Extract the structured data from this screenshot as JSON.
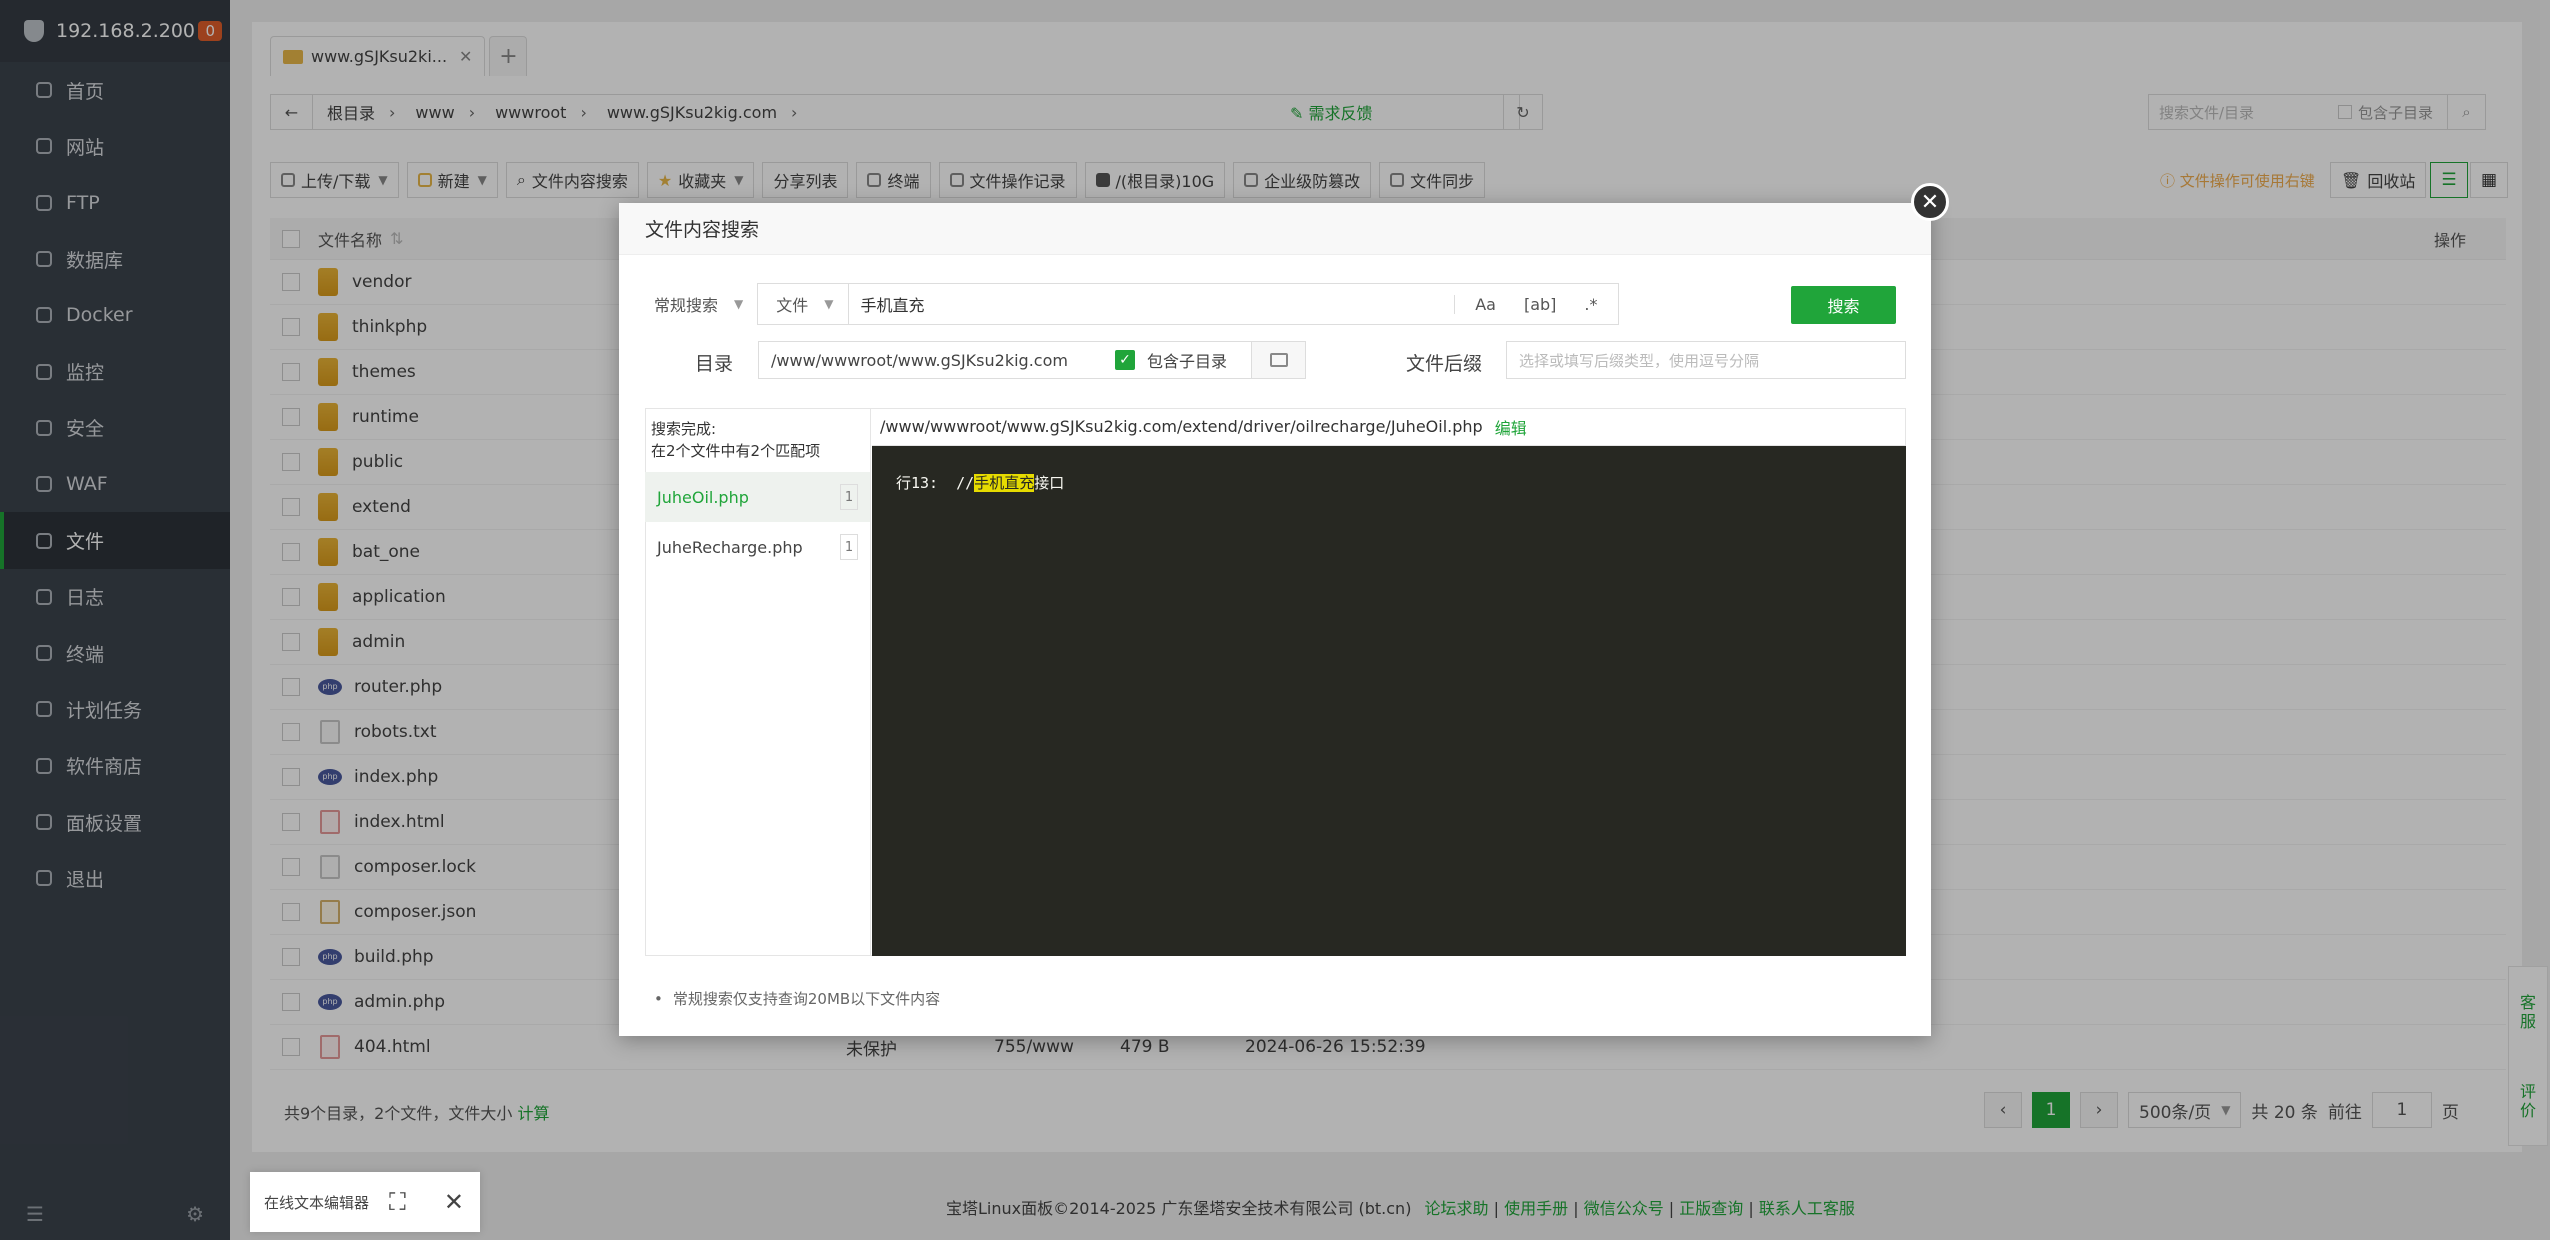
{
  "sidebar": {
    "server_ip": "192.168.2.200",
    "badge": "0",
    "items": [
      {
        "label": "首页",
        "icon": "home-icon"
      },
      {
        "label": "网站",
        "icon": "globe-icon"
      },
      {
        "label": "FTP",
        "icon": "ftp-icon"
      },
      {
        "label": "数据库",
        "icon": "database-icon"
      },
      {
        "label": "Docker",
        "icon": "docker-icon"
      },
      {
        "label": "监控",
        "icon": "monitor-icon"
      },
      {
        "label": "安全",
        "icon": "shield-icon"
      },
      {
        "label": "WAF",
        "icon": "waf-icon"
      },
      {
        "label": "文件",
        "icon": "folder-icon",
        "active": true
      },
      {
        "label": "日志",
        "icon": "log-icon"
      },
      {
        "label": "终端",
        "icon": "terminal-icon"
      },
      {
        "label": "计划任务",
        "icon": "schedule-icon"
      },
      {
        "label": "软件商店",
        "icon": "store-icon"
      },
      {
        "label": "面板设置",
        "icon": "settings-icon"
      },
      {
        "label": "退出",
        "icon": "logout-icon"
      }
    ]
  },
  "tabs": [
    {
      "label": "www.gSJKsu2ki..."
    }
  ],
  "breadcrumb": [
    "根目录",
    "www",
    "wwwroot",
    "www.gSJKsu2kig.com"
  ],
  "feedback": "需求反馈",
  "search": {
    "placeholder": "搜索文件/目录",
    "include_sub": "包含子目录"
  },
  "toolbar": {
    "upload": "上传/下载",
    "new": "新建",
    "content_search": "文件内容搜索",
    "favorites": "收藏夹",
    "share_list": "分享列表",
    "terminal": "终端",
    "file_log": "文件操作记录",
    "disk": "/(根目录)10G",
    "tamper": "企业级防篡改",
    "sync": "文件同步",
    "tip": "文件操作可使用右键",
    "recycle": "回收站"
  },
  "table": {
    "col_name": "文件名称",
    "col_ops": "操作",
    "rows": [
      {
        "name": "vendor",
        "type": "folder"
      },
      {
        "name": "thinkphp",
        "type": "folder"
      },
      {
        "name": "themes",
        "type": "folder"
      },
      {
        "name": "runtime",
        "type": "folder"
      },
      {
        "name": "public",
        "type": "folder"
      },
      {
        "name": "extend",
        "type": "folder"
      },
      {
        "name": "bat_one",
        "type": "folder"
      },
      {
        "name": "application",
        "type": "folder"
      },
      {
        "name": "admin",
        "type": "folder"
      },
      {
        "name": "router.php",
        "type": "php"
      },
      {
        "name": "robots.txt",
        "type": "doc"
      },
      {
        "name": "index.php",
        "type": "php"
      },
      {
        "name": "index.html",
        "type": "html"
      },
      {
        "name": "composer.lock",
        "type": "doc"
      },
      {
        "name": "composer.json",
        "type": "json"
      },
      {
        "name": "build.php",
        "type": "php"
      },
      {
        "name": "admin.php",
        "type": "php"
      },
      {
        "name": "404.html",
        "type": "html",
        "protect": "未保护",
        "perm": "755/www",
        "size": "479 B",
        "mtime": "2024-06-26 15:52:39"
      }
    ]
  },
  "footer": {
    "summary": "共9个目录，2个文件，文件大小",
    "calc": "计算"
  },
  "pager": {
    "current": "1",
    "per_page": "500条/页",
    "total": "共 20 条",
    "goto": "前往",
    "goto_value": "1",
    "page_unit": "页"
  },
  "copyright": {
    "text": "宝塔Linux面板©2014-2025 广东堡塔安全技术有限公司 (bt.cn)",
    "links": [
      "论坛求助",
      "使用手册",
      "微信公众号",
      "正版查询",
      "联系人工客服"
    ]
  },
  "editor_pill": "在线文本编辑器",
  "side_float": [
    "客服",
    "评价"
  ],
  "modal": {
    "title": "文件内容搜索",
    "mode": "常规搜索",
    "scope": "文件",
    "keyword": "手机直充",
    "opt_case": "Aa",
    "opt_word": "[ab]",
    "opt_regex": ".*",
    "search_btn": "搜索",
    "dir_label": "目录",
    "dir_value": "/www/wwwroot/www.gSJKsu2kig.com",
    "include_sub": "包含子目录",
    "ext_label": "文件后缀",
    "ext_placeholder": "选择或填写后缀类型，使用逗号分隔",
    "status_line1": "搜索完成:",
    "status_line2": "在2个文件中有2个匹配项",
    "results": [
      {
        "file": "JuheOil.php",
        "count": "1"
      },
      {
        "file": "JuheRecharge.php",
        "count": "1"
      }
    ],
    "result_path": "/www/wwwroot/www.gSJKsu2kig.com/extend/driver/oilrecharge/JuheOil.php",
    "edit": "编辑",
    "code_line_prefix": "行13:  //",
    "code_match": "手机直充",
    "code_suffix": "接口",
    "note": "常规搜索仅支持查询20MB以下文件内容"
  }
}
